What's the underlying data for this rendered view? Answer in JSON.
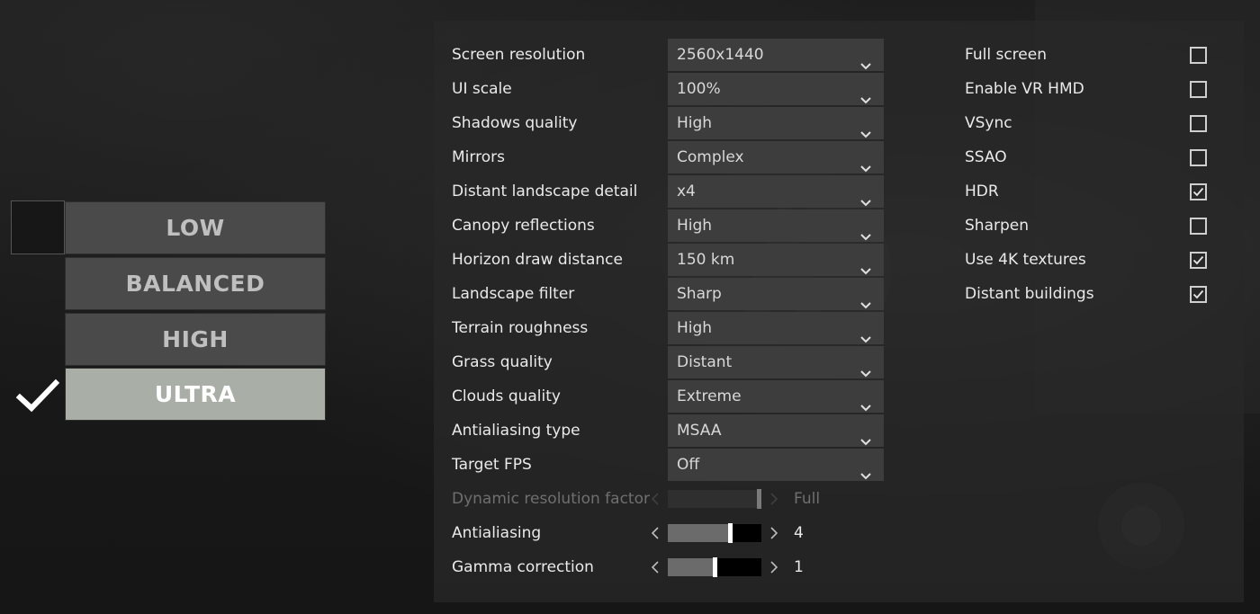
{
  "presets": {
    "items": [
      {
        "label": "LOW",
        "selected": false
      },
      {
        "label": "BALANCED",
        "selected": false
      },
      {
        "label": "HIGH",
        "selected": false
      },
      {
        "label": "ULTRA",
        "selected": true
      }
    ],
    "check_icon": "checkmark-icon"
  },
  "settings": {
    "dropdowns": [
      {
        "label": "Screen resolution",
        "value": "2560x1440"
      },
      {
        "label": "UI scale",
        "value": "100%"
      },
      {
        "label": "Shadows quality",
        "value": "High"
      },
      {
        "label": "Mirrors",
        "value": "Complex"
      },
      {
        "label": "Distant landscape detail",
        "value": "x4"
      },
      {
        "label": "Canopy reflections",
        "value": "High"
      },
      {
        "label": "Horizon draw distance",
        "value": "150 km"
      },
      {
        "label": "Landscape filter",
        "value": "Sharp"
      },
      {
        "label": "Terrain roughness",
        "value": "High"
      },
      {
        "label": "Grass quality",
        "value": "Distant"
      },
      {
        "label": "Clouds quality",
        "value": "Extreme"
      },
      {
        "label": "Antialiasing type",
        "value": "MSAA"
      },
      {
        "label": "Target FPS",
        "value": "Off"
      }
    ],
    "sliders": [
      {
        "label": "Dynamic resolution factor",
        "value": "Full",
        "level": 1.0,
        "disabled": true
      },
      {
        "label": "Antialiasing",
        "value": "4",
        "level": 0.66,
        "disabled": false
      },
      {
        "label": "Gamma correction",
        "value": "1",
        "level": 0.5,
        "disabled": false
      }
    ],
    "checkboxes": [
      {
        "label": "Full screen",
        "checked": false
      },
      {
        "label": "Enable VR HMD",
        "checked": false
      },
      {
        "label": "VSync",
        "checked": false
      },
      {
        "label": "SSAO",
        "checked": false
      },
      {
        "label": "HDR",
        "checked": true
      },
      {
        "label": "Sharpen",
        "checked": false
      },
      {
        "label": "Use 4K textures",
        "checked": true
      },
      {
        "label": "Distant buildings",
        "checked": true
      }
    ]
  },
  "colors": {
    "panel_bg": "#282828",
    "control_bg": "#3d3d3d",
    "preset_bg": "#4a4a4a",
    "preset_selected_bg": "#a9aea6",
    "text": "#eaeaea",
    "disabled_text": "#6f6f6f"
  }
}
